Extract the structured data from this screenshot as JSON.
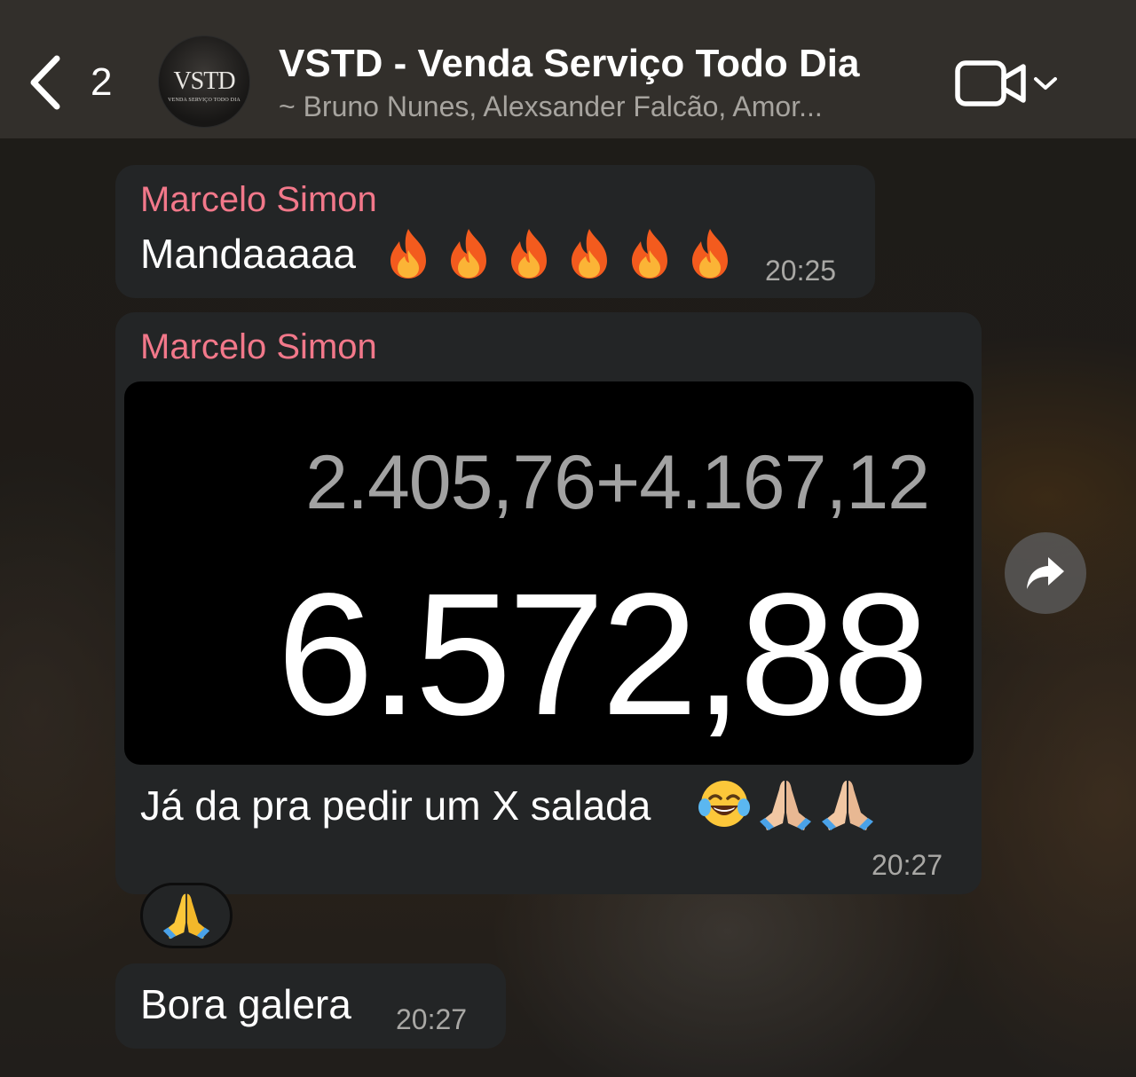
{
  "header": {
    "back_count": "2",
    "avatar_logo": "VSTD",
    "avatar_subtitle": "VENDA SERVIÇO TODO DIA",
    "title": "VSTD - Venda Serviço Todo Dia",
    "subtitle": "~ Bruno Nunes, Alexsander Falcão, Amor...",
    "icons": {
      "back": "chevron-left-icon",
      "video": "video-camera-icon",
      "dropdown": "chevron-down-icon"
    }
  },
  "messages": [
    {
      "sender": "Marcelo Simon",
      "text": "Mandaaaaa",
      "emojis": "fire x6",
      "time": "20:25"
    },
    {
      "sender": "Marcelo Simon",
      "image": {
        "calc_expression": "2.405,76+4.167,12",
        "calc_result": "6.572,88"
      },
      "caption": "Já da pra pedir um X salada",
      "caption_emojis": "tears-of-joy, folded-hands x2",
      "time": "20:27",
      "reaction": "folded-hands"
    },
    {
      "text": "Bora galera",
      "time": "20:27"
    }
  ],
  "colors": {
    "sender_name": "#f2788a",
    "bubble": "#232526",
    "header": "#34312d",
    "timestamp": "#a9a8a5"
  }
}
